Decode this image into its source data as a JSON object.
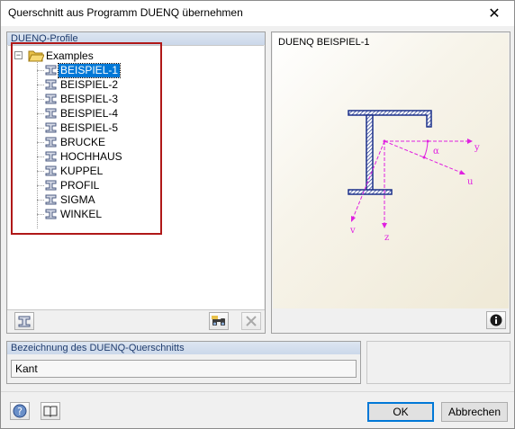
{
  "window": {
    "title": "Querschnitt aus Programm DUENQ übernehmen",
    "close_glyph": "✕"
  },
  "left_panel": {
    "header": "DUENQ-Profile",
    "tree": {
      "root_label": "Examples",
      "root_expander": "−",
      "items": [
        {
          "label": "BEISPIEL-1",
          "selected": true
        },
        {
          "label": "BEISPIEL-2",
          "selected": false
        },
        {
          "label": "BEISPIEL-3",
          "selected": false
        },
        {
          "label": "BEISPIEL-4",
          "selected": false
        },
        {
          "label": "BEISPIEL-5",
          "selected": false
        },
        {
          "label": "BRUCKE",
          "selected": false
        },
        {
          "label": "HOCHHAUS",
          "selected": false
        },
        {
          "label": "KUPPEL",
          "selected": false
        },
        {
          "label": "PROFIL",
          "selected": false
        },
        {
          "label": "SIGMA",
          "selected": false
        },
        {
          "label": "WINKEL",
          "selected": false
        }
      ]
    },
    "toolbar_icons": [
      "section-import-icon",
      "search-binoculars-icon",
      "delete-icon"
    ]
  },
  "preview": {
    "title": "DUENQ BEISPIEL-1",
    "axis_labels": {
      "y": "y",
      "z": "z",
      "u": "u",
      "v": "v",
      "alpha": "α"
    },
    "info_icon": "info-icon",
    "colors": {
      "section_outline": "#1a2f8a",
      "axes": "#e020e0"
    }
  },
  "description": {
    "header": "Bezeichnung des DUENQ-Querschnitts",
    "value": "Kant"
  },
  "footer": {
    "help_icon": "help-icon",
    "book_icon": "book-icon",
    "ok_label": "OK",
    "cancel_label": "Abbrechen"
  },
  "colors": {
    "selection": "#0078d7",
    "highlight_border": "#b01818",
    "group_header_text": "#1f3c6e"
  }
}
